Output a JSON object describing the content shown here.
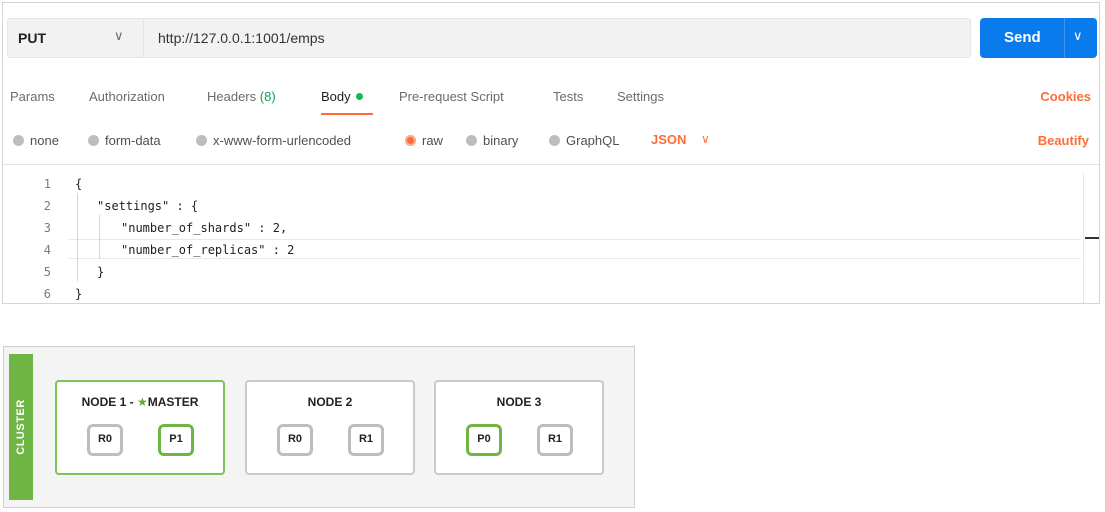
{
  "request": {
    "method": "PUT",
    "url": "http://127.0.0.1:1001/emps",
    "send_label": "Send"
  },
  "tabs": [
    {
      "label": "Params"
    },
    {
      "label": "Authorization"
    },
    {
      "label": "Headers",
      "count": "(8)"
    },
    {
      "label": "Body",
      "active": true
    },
    {
      "label": "Pre-request Script"
    },
    {
      "label": "Tests"
    },
    {
      "label": "Settings"
    }
  ],
  "cookies_label": "Cookies",
  "body_options": [
    {
      "label": "none",
      "selected": false
    },
    {
      "label": "form-data",
      "selected": false
    },
    {
      "label": "x-www-form-urlencoded",
      "selected": false
    },
    {
      "label": "raw",
      "selected": true
    },
    {
      "label": "binary",
      "selected": false
    },
    {
      "label": "GraphQL",
      "selected": false
    }
  ],
  "format_select": "JSON",
  "beautify_label": "Beautify",
  "editor": {
    "line_numbers": [
      "1",
      "2",
      "3",
      "4",
      "5",
      "6"
    ],
    "lines": [
      "{",
      "\"settings\" : {",
      "\"number_of_shards\" : 2,",
      "\"number_of_replicas\" : 2",
      "}",
      "}"
    ]
  },
  "cluster": {
    "label": "CLUSTER",
    "nodes": [
      {
        "title": "NODE 1 - ",
        "master_label": "MASTER",
        "shards": [
          {
            "label": "R0"
          },
          {
            "label": "P1"
          }
        ]
      },
      {
        "title": "NODE 2",
        "shards": [
          {
            "label": "R0"
          },
          {
            "label": "R1"
          }
        ]
      },
      {
        "title": "NODE 3",
        "shards": [
          {
            "label": "P0"
          },
          {
            "label": "R1"
          }
        ]
      }
    ]
  },
  "colors": {
    "accent_orange": "#ff6c37",
    "send_blue": "#097bed",
    "cluster_green": "#6eb543"
  },
  "icons": {
    "method_dropdown": "chevron-down-icon",
    "send_dropdown": "chevron-down-icon",
    "master_marker": "star-icon"
  }
}
